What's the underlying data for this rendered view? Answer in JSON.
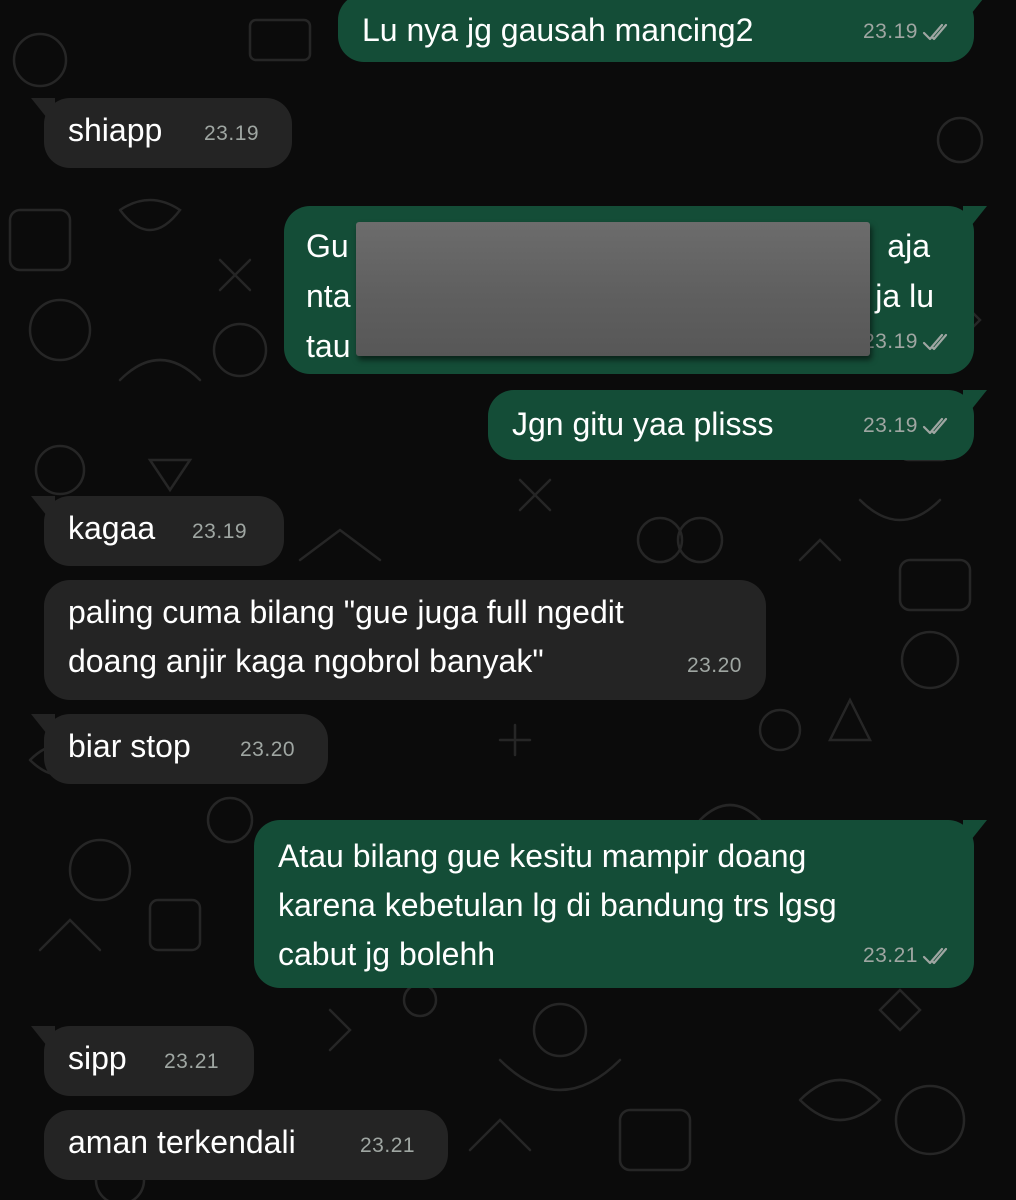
{
  "colors": {
    "background": "#0b0b0b",
    "incoming_bubble": "#242424",
    "outgoing_bubble": "#144d37",
    "timestamp": "#9fa6a2"
  },
  "messages": [
    {
      "direction": "outgoing",
      "text": "Lu nya jg gausah mancing2",
      "time": "23.19",
      "status_icon": "double-check-icon"
    },
    {
      "direction": "incoming",
      "text": "shiapp",
      "time": "23.19"
    },
    {
      "direction": "outgoing",
      "text_visible_fragments": [
        "Gu",
        "aja",
        "nta",
        "ja lu",
        "tau"
      ],
      "time": "23.19",
      "status_icon": "double-check-icon",
      "redacted": true
    },
    {
      "direction": "outgoing",
      "text": "Jgn gitu yaa plisss",
      "time": "23.19",
      "status_icon": "double-check-icon"
    },
    {
      "direction": "incoming",
      "text": "kagaa",
      "time": "23.19"
    },
    {
      "direction": "incoming",
      "text": "paling cuma bilang \"gue juga full ngedit\ndoang anjir kaga ngobrol banyak\"",
      "time": "23.20"
    },
    {
      "direction": "incoming",
      "text": "biar stop",
      "time": "23.20"
    },
    {
      "direction": "outgoing",
      "text": "Atau bilang gue kesitu mampir doang\nkarena kebetulan lg di bandung trs lgsg\ncabut jg bolehh",
      "time": "23.21",
      "status_icon": "double-check-icon"
    },
    {
      "direction": "incoming",
      "text": "sipp",
      "time": "23.21"
    },
    {
      "direction": "incoming",
      "text": "aman terkendali",
      "time": "23.21"
    }
  ]
}
